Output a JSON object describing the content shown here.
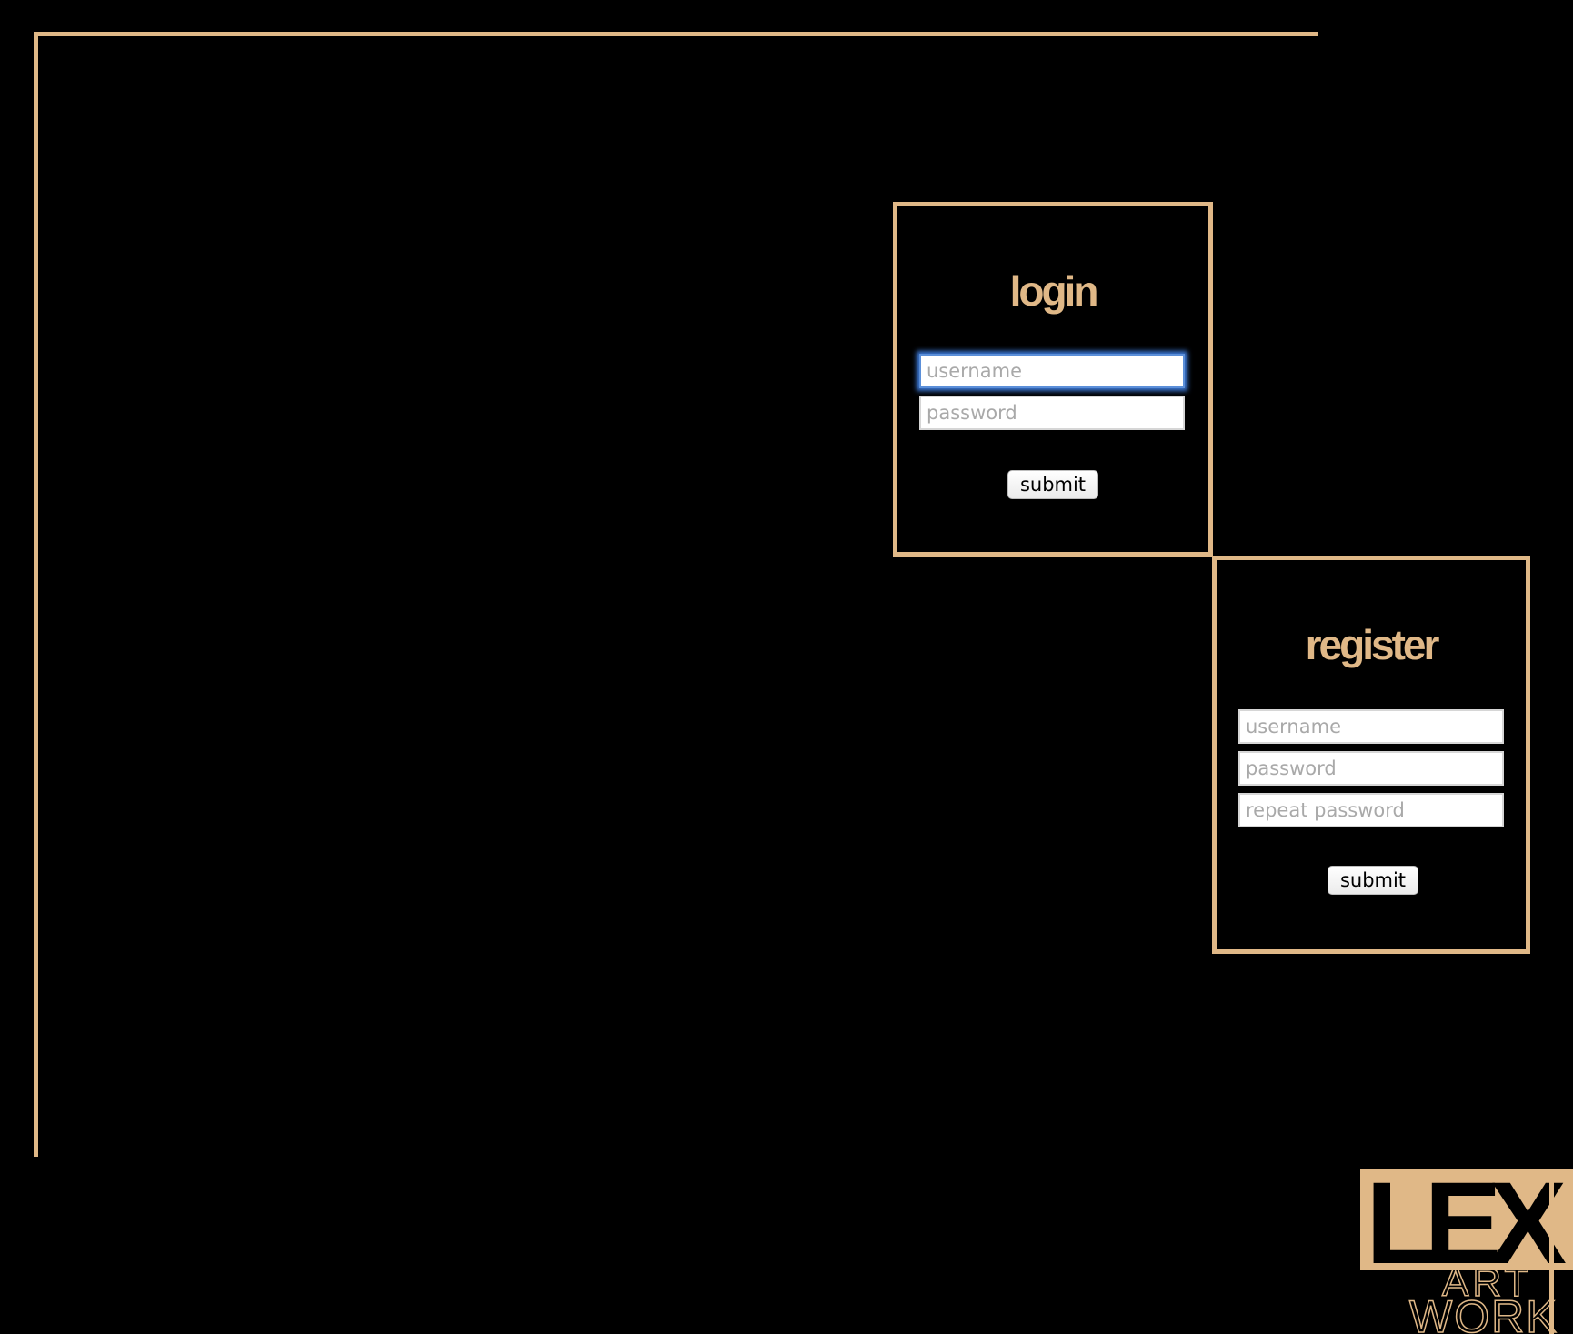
{
  "login": {
    "title": "login",
    "username_placeholder": "username",
    "password_placeholder": "password",
    "submit_label": "submit"
  },
  "register": {
    "title": "register",
    "username_placeholder": "username",
    "password_placeholder": "password",
    "repeat_password_placeholder": "repeat password",
    "submit_label": "submit"
  },
  "logo": {
    "line1": "LEX",
    "line2": "ART",
    "line3": "WORK"
  },
  "colors": {
    "accent": "#e0b887",
    "background": "#000000",
    "focus_ring": "#3d7ad8"
  }
}
